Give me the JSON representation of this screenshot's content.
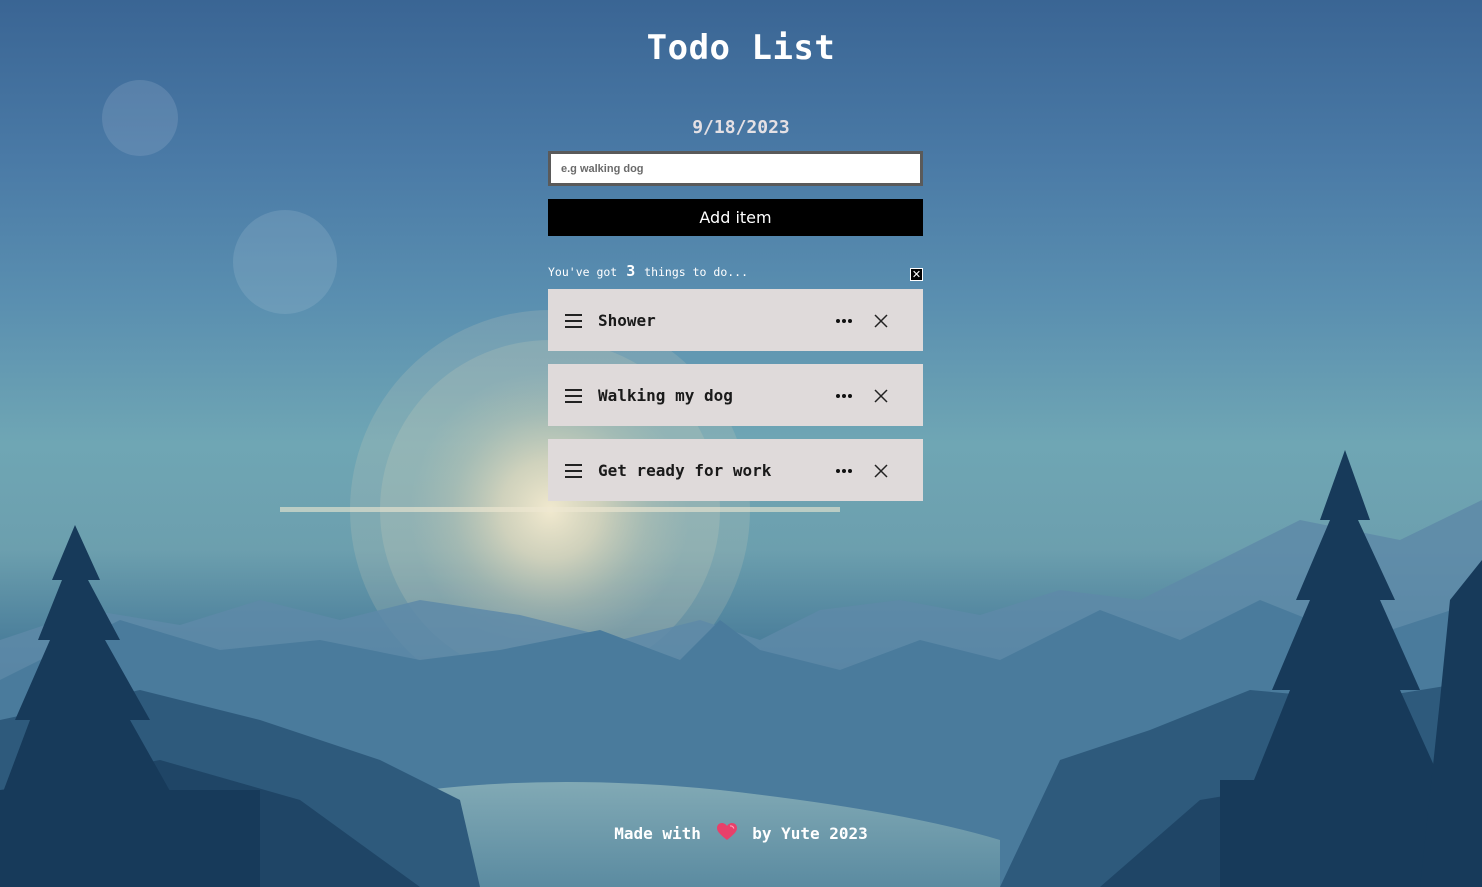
{
  "app": {
    "title": "Todo List",
    "date": "9/18/2023"
  },
  "form": {
    "input_placeholder": "e.g walking dog",
    "input_value": "",
    "add_button_label": "Add item"
  },
  "counter": {
    "prefix": "You've got",
    "count": "3",
    "suffix": "things to do...",
    "clear_label": "✕"
  },
  "todos": [
    {
      "text": "Shower",
      "handle_icon": "hamburger-icon",
      "more_icon": "more-horizontal-icon",
      "delete_icon": "close-icon"
    },
    {
      "text": "Walking my dog",
      "handle_icon": "hamburger-icon",
      "more_icon": "more-horizontal-icon",
      "delete_icon": "close-icon"
    },
    {
      "text": "Get ready for work",
      "handle_icon": "hamburger-icon",
      "more_icon": "more-horizontal-icon",
      "delete_icon": "close-icon"
    }
  ],
  "footer": {
    "before": "Made with",
    "heart_icon": "heart-icon",
    "after": "by Yute 2023"
  },
  "colors": {
    "sky_top": "#3a6594",
    "sky_mid": "#6fa6b4",
    "item_bg": "#dfdada",
    "button_bg": "#000000",
    "heart": "#e8406a"
  }
}
